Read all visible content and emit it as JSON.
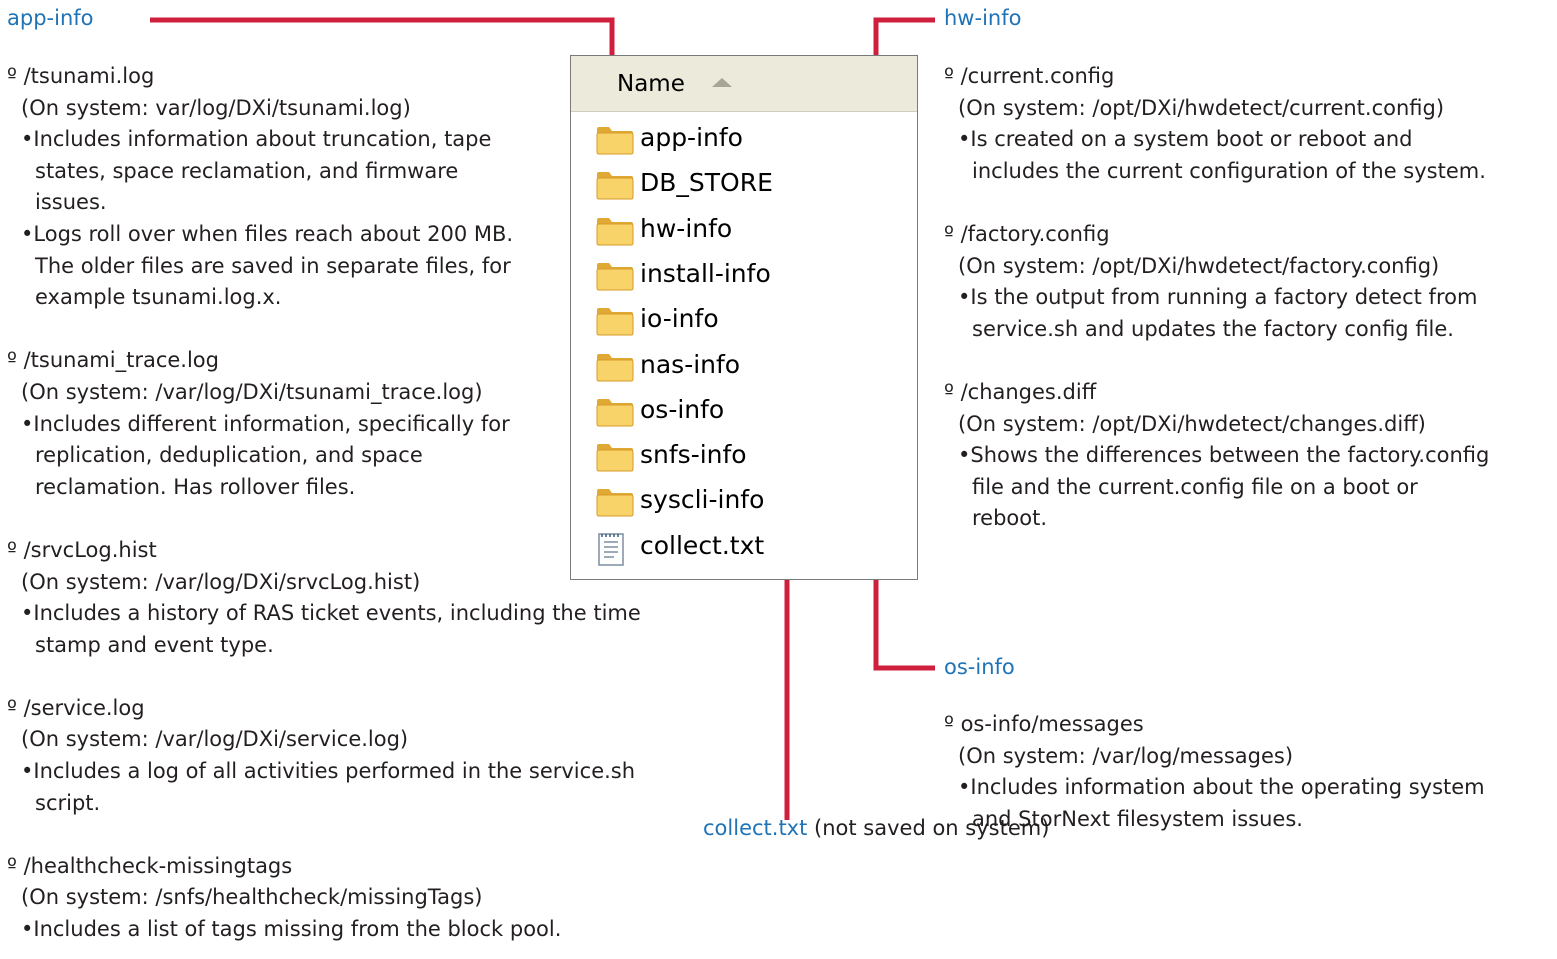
{
  "explorer": {
    "column_header": "Name",
    "items": [
      {
        "name": "app-info",
        "icon": "folder-icon"
      },
      {
        "name": "DB_STORE",
        "icon": "folder-icon"
      },
      {
        "name": "hw-info",
        "icon": "folder-icon"
      },
      {
        "name": "install-info",
        "icon": "folder-icon"
      },
      {
        "name": "io-info",
        "icon": "folder-icon"
      },
      {
        "name": "nas-info",
        "icon": "folder-icon"
      },
      {
        "name": "os-info",
        "icon": "folder-icon"
      },
      {
        "name": "snfs-info",
        "icon": "folder-icon"
      },
      {
        "name": "syscli-info",
        "icon": "folder-icon"
      },
      {
        "name": "collect.txt",
        "icon": "text-file-icon"
      }
    ]
  },
  "colors": {
    "connector": "#d01f3c",
    "heading": "#1f73b7",
    "folder": "#f2c24b"
  },
  "app_info": {
    "heading": "app-info",
    "entries": [
      {
        "file": "º /tsunami.log",
        "system": "(On system: var/log/DXi/tsunami.log)",
        "bullets": [
          [
            "•Includes information about truncation, tape",
            "states, space reclamation, and firmware",
            "issues."
          ],
          [
            "•Logs roll over when files reach about 200 MB.",
            "The older files are saved in separate files, for",
            "example tsunami.log.x."
          ]
        ]
      },
      {
        "file": "º /tsunami_trace.log",
        "system": "(On system: /var/log/DXi/tsunami_trace.log)",
        "bullets": [
          [
            "•Includes different information, specifically for",
            "replication, deduplication, and space",
            "reclamation. Has rollover files."
          ]
        ]
      },
      {
        "file": "º /srvcLog.hist",
        "system": "(On system: /var/log/DXi/srvcLog.hist)",
        "bullets": [
          [
            "•Includes a history of RAS ticket events, including the time",
            "stamp and event type."
          ]
        ]
      },
      {
        "file": "º /service.log",
        "system": "(On system: /var/log/DXi/service.log)",
        "bullets": [
          [
            "•Includes a log of all activities performed in the service.sh",
            "script."
          ]
        ]
      },
      {
        "file": "º /healthcheck-missingtags",
        "system": "(On system: /snfs/healthcheck/missingTags)",
        "bullets": [
          [
            "•Includes a list of tags missing from the block pool."
          ]
        ]
      }
    ]
  },
  "hw_info": {
    "heading": "hw-info",
    "entries": [
      {
        "file": "º /current.config",
        "system": "(On system: /opt/DXi/hwdetect/current.config)",
        "bullets": [
          [
            "•Is created on a system boot or reboot and",
            "includes the current configuration of the system."
          ]
        ]
      },
      {
        "file": "º /factory.config",
        "system": "(On system: /opt/DXi/hwdetect/factory.config)",
        "bullets": [
          [
            "•Is the output from running a factory detect from",
            "service.sh and updates the factory config file."
          ]
        ]
      },
      {
        "file": "º /changes.diff",
        "system": "(On system: /opt/DXi/hwdetect/changes.diff)",
        "bullets": [
          [
            "•Shows the differences between the factory.config",
            "file and the current.config file on a boot or",
            "reboot."
          ]
        ]
      }
    ]
  },
  "os_info": {
    "heading": "os-info",
    "entries": [
      {
        "file": "º os-info/messages",
        "system": "(On system: /var/log/messages)",
        "bullets": [
          [
            "•Includes information about the operating system",
            "and StorNext filesystem issues."
          ]
        ]
      }
    ]
  },
  "collect": {
    "heading": "collect.txt",
    "note": "(not saved on system)"
  }
}
